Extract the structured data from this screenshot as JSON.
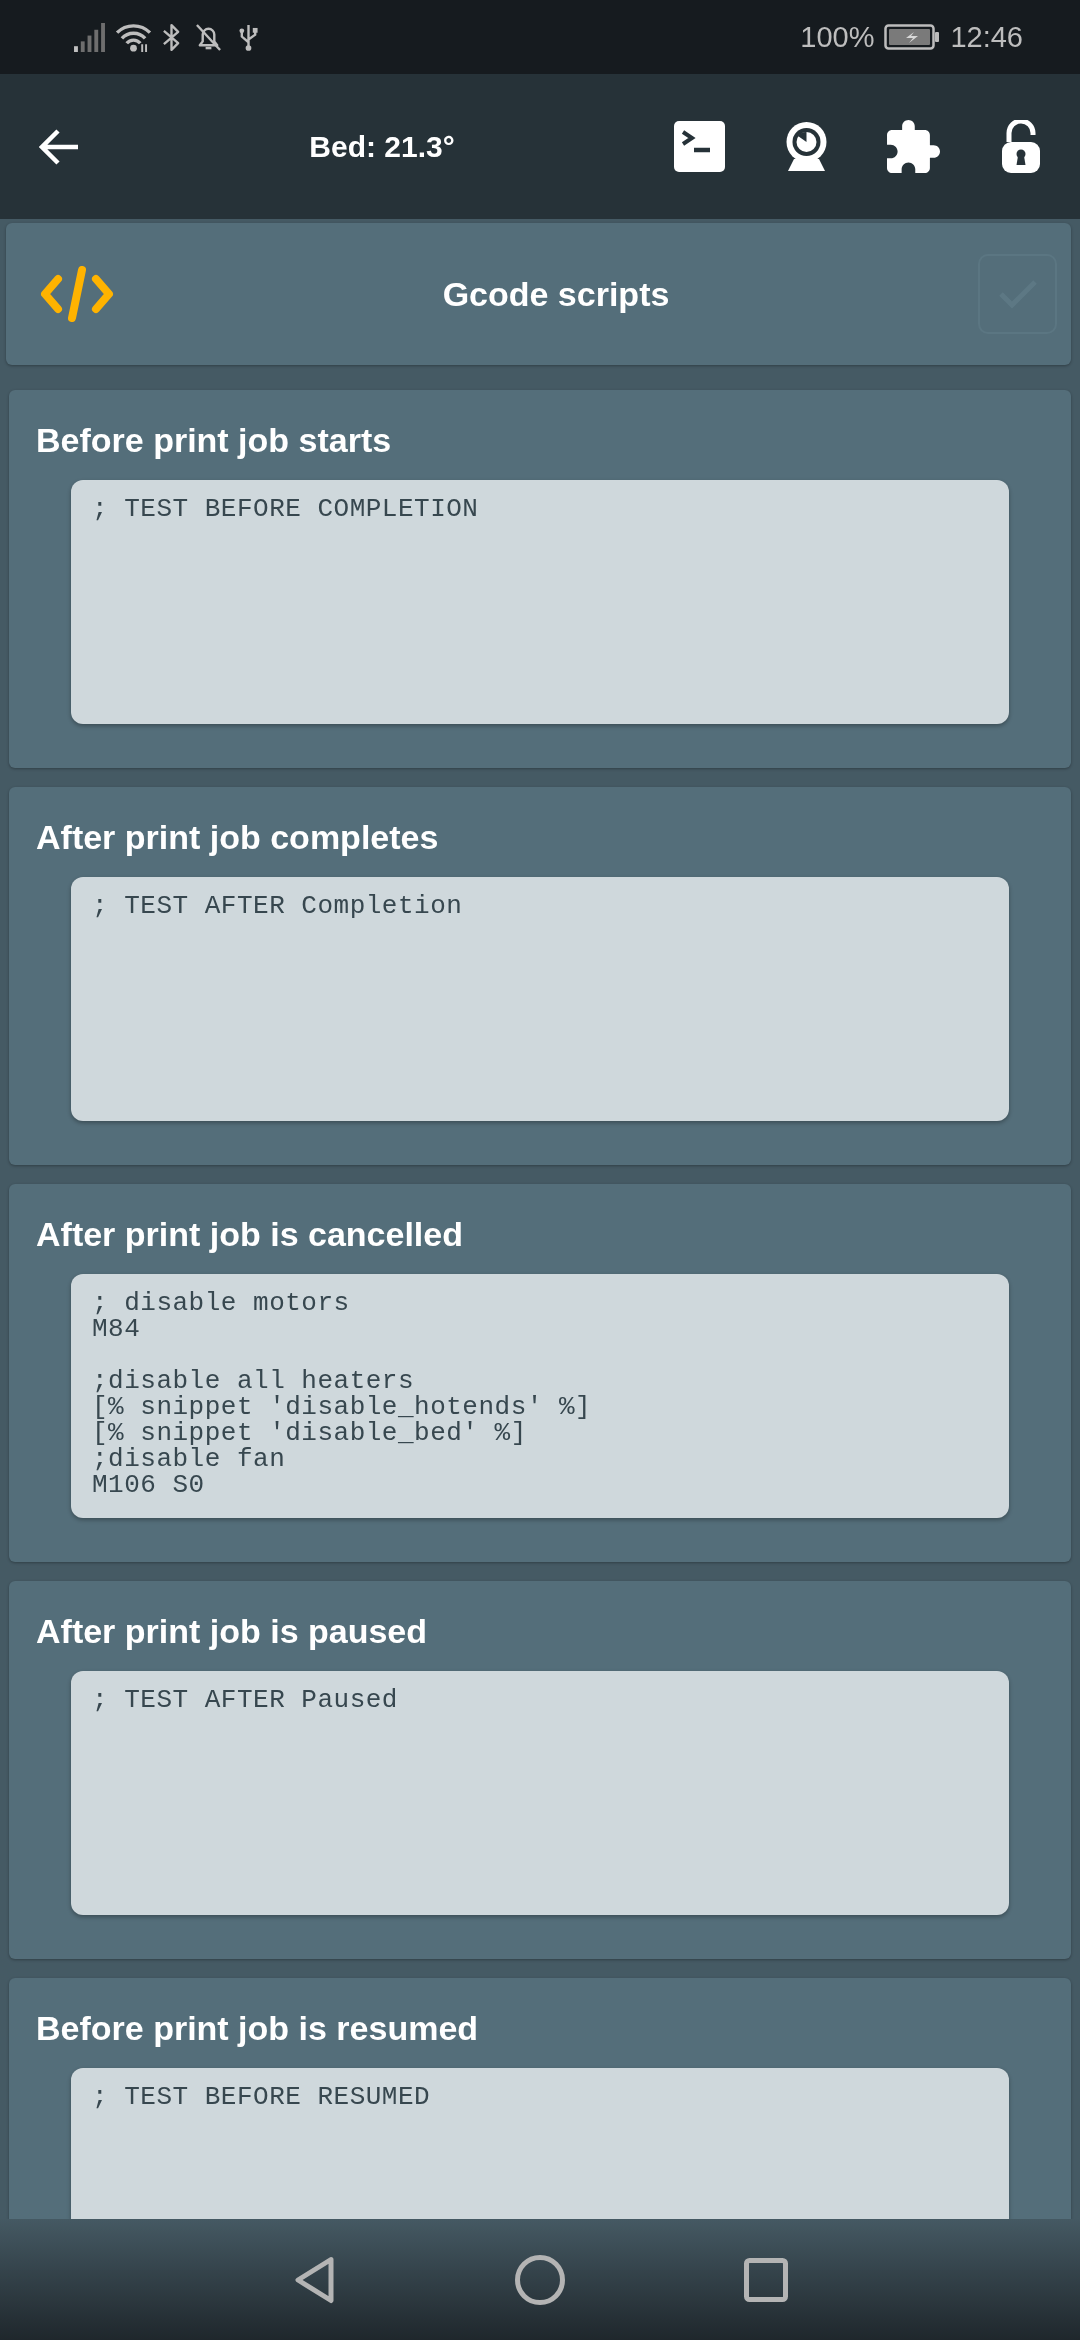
{
  "status_bar": {
    "battery": "100%",
    "time": "12:46"
  },
  "app_bar": {
    "title": "Bed: 21.3°"
  },
  "header": {
    "title": "Gcode scripts",
    "save_button": {
      "disabled": true
    }
  },
  "scripts": [
    {
      "label": "Before print job starts",
      "value": "; TEST BEFORE COMPLETION"
    },
    {
      "label": "After print job completes",
      "value": "; TEST AFTER Completion"
    },
    {
      "label": "After print job is cancelled",
      "value": "; disable motors\nM84\n\n;disable all heaters\n[% snippet 'disable_hotends' %]\n[% snippet 'disable_bed' %]\n;disable fan\nM106 S0"
    },
    {
      "label": "After print job is paused",
      "value": "; TEST AFTER Paused"
    },
    {
      "label": "Before print job is resumed",
      "value": "; TEST BEFORE RESUMED"
    }
  ]
}
